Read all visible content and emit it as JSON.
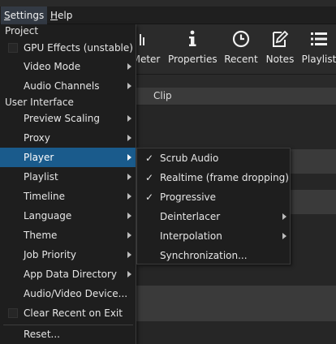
{
  "menubar": {
    "settings_label": "Settings",
    "settings_mnemonic": "S",
    "settings_rest": "ettings",
    "help_label": "Help",
    "help_mnemonic": "H",
    "help_rest": "elp"
  },
  "toolbar": {
    "items": [
      {
        "label": "Meter",
        "icon": "meter-icon"
      },
      {
        "label": "Properties",
        "icon": "info-icon"
      },
      {
        "label": "Recent",
        "icon": "clock-icon"
      },
      {
        "label": "Notes",
        "icon": "notes-edit-icon"
      },
      {
        "label": "Playlist",
        "icon": "list-icon"
      }
    ]
  },
  "background": {
    "panel_header": "Clip"
  },
  "settings_menu": {
    "sections": {
      "project": "Project",
      "user_interface": "User Interface"
    },
    "items": [
      {
        "label": "GPU Effects (unstable)",
        "submenu": false
      },
      {
        "label": "Video Mode",
        "submenu": true
      },
      {
        "label": "Audio Channels",
        "submenu": true
      },
      {
        "label": "Preview Scaling",
        "submenu": true
      },
      {
        "label": "Proxy",
        "submenu": true
      },
      {
        "label": "Player",
        "submenu": true,
        "active": true
      },
      {
        "label": "Playlist",
        "submenu": true
      },
      {
        "label": "Timeline",
        "submenu": true
      },
      {
        "label": "Language",
        "submenu": true
      },
      {
        "label": "Theme",
        "submenu": true
      },
      {
        "label": "Job Priority",
        "submenu": true
      },
      {
        "label": "App Data Directory",
        "submenu": true
      },
      {
        "label": "Audio/Video Device...",
        "submenu": false
      },
      {
        "label": "Clear Recent on Exit",
        "submenu": false
      },
      {
        "label": "Reset...",
        "submenu": false
      }
    ]
  },
  "player_submenu": {
    "check_glyph": "✓",
    "items": [
      {
        "label": "Scrub Audio",
        "checked": true,
        "submenu": false
      },
      {
        "label": "Realtime (frame dropping)",
        "checked": true,
        "submenu": false
      },
      {
        "label": "Progressive",
        "checked": true,
        "submenu": false
      },
      {
        "label": "Deinterlacer",
        "checked": false,
        "submenu": true
      },
      {
        "label": "Interpolation",
        "checked": false,
        "submenu": true
      },
      {
        "label": "Synchronization...",
        "checked": false,
        "submenu": false
      }
    ]
  },
  "colors": {
    "menu_bg": "#1e1e1e",
    "highlight": "#1a5b8c",
    "text": "#e6e6e6",
    "window_bg": "#2a2a2a"
  }
}
